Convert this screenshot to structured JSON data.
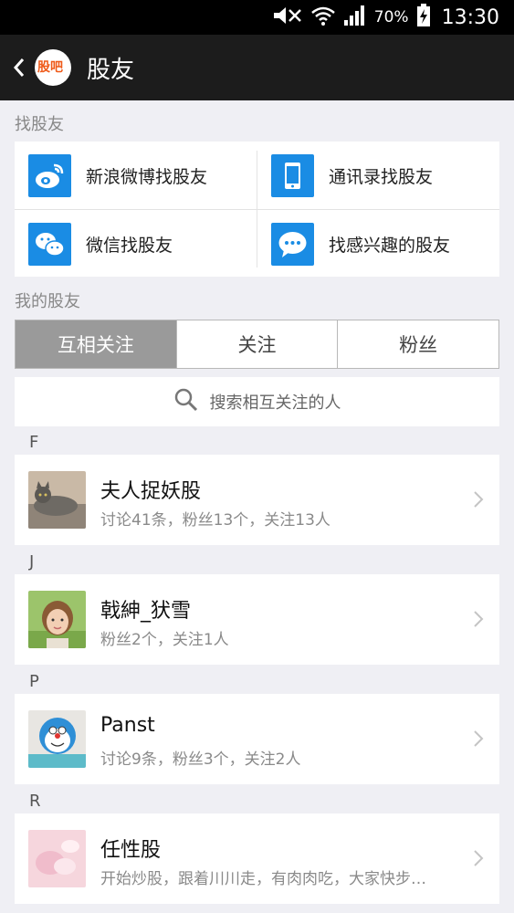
{
  "status_bar": {
    "battery": "70%",
    "time": "13:30"
  },
  "app_bar": {
    "logo_text": "股吧",
    "title": "股友"
  },
  "find_section": {
    "label": "找股友",
    "items": [
      {
        "label": "新浪微博找股友",
        "icon": "weibo-icon"
      },
      {
        "label": "通讯录找股友",
        "icon": "phone-contacts-icon"
      },
      {
        "label": "微信找股友",
        "icon": "wechat-icon"
      },
      {
        "label": "找感兴趣的股友",
        "icon": "chat-bubble-icon"
      }
    ]
  },
  "my_friends": {
    "label": "我的股友",
    "tabs": [
      {
        "label": "互相关注",
        "active": true
      },
      {
        "label": "关注",
        "active": false
      },
      {
        "label": "粉丝",
        "active": false
      }
    ],
    "search_placeholder": "搜索相互关注的人"
  },
  "groups": [
    {
      "letter": "F",
      "name": "夫人捉妖股",
      "meta": "讨论41条，粉丝13个，关注13人"
    },
    {
      "letter": "J",
      "name": "戟紳_犾雪",
      "meta": "粉丝2个，关注1人"
    },
    {
      "letter": "P",
      "name": "Panst",
      "meta": "讨论9条，粉丝3个，关注2人"
    },
    {
      "letter": "R",
      "name": "任性股",
      "meta": "开始炒股，跟着川川走，有肉肉吃，大家快步…"
    }
  ],
  "colors": {
    "accent_blue": "#1a8ce4",
    "logo_orange": "#ef5a19",
    "active_tab": "#9a9a9a"
  }
}
